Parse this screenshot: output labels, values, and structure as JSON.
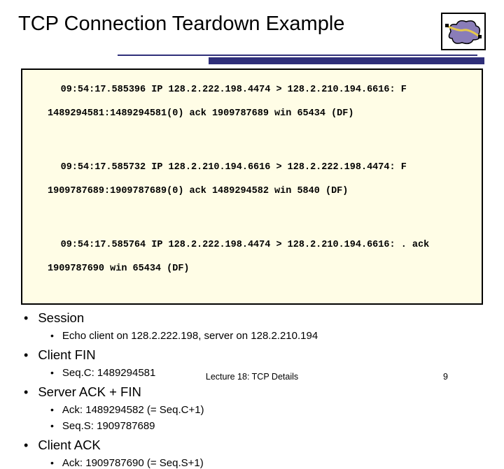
{
  "title": "TCP Connection Teardown Example",
  "packets": {
    "p1a": "09:54:17.585396 IP 128.2.222.198.4474 > 128.2.210.194.6616: F",
    "p1b": "1489294581:1489294581(0) ack 1909787689 win 65434 (DF)",
    "p2a": "09:54:17.585732 IP 128.2.210.194.6616 > 128.2.222.198.4474: F",
    "p2b": "1909787689:1909787689(0) ack 1489294582 win 5840 (DF)",
    "p3a": "09:54:17.585764 IP 128.2.222.198.4474 > 128.2.210.194.6616: . ack",
    "p3b": "1909787690 win 65434 (DF)"
  },
  "bullets": {
    "session": "Session",
    "session_sub": "Echo client on 128.2.222.198, server on 128.2.210.194",
    "clientfin": "Client FIN",
    "clientfin_sub": "Seq.C: 1489294581",
    "serverackfin": "Server ACK + FIN",
    "serverackfin_sub1": "Ack: 1489294582 (= Seq.C+1)",
    "serverackfin_sub2": "Seq.S: 1909787689",
    "clientack": "Client ACK",
    "clientack_sub": "Ack: 1909787690 (= Seq.S+1)"
  },
  "footer": {
    "center": "Lecture 18: TCP Details",
    "page": "9"
  },
  "icon_name": "network-cloud-icon"
}
